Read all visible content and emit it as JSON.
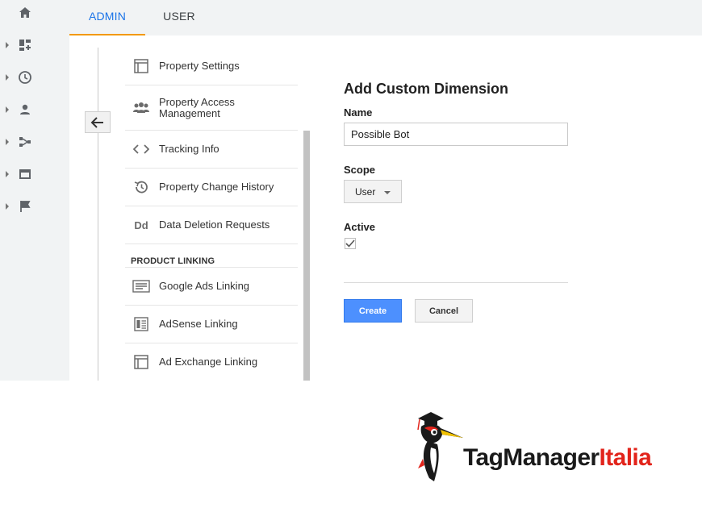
{
  "tabs": [
    {
      "label": "ADMIN",
      "active": true
    },
    {
      "label": "USER",
      "active": false
    }
  ],
  "rail": {
    "items": [
      "home-icon",
      "customization-icon",
      "realtime-clock-icon",
      "audience-person-icon",
      "acquisition-icon",
      "behavior-icon",
      "conversions-flag-icon"
    ]
  },
  "property_menu": {
    "items": [
      {
        "label": "Property Settings",
        "icon": "property-settings-icon"
      },
      {
        "label": "Property Access Management",
        "icon": "people-icon"
      },
      {
        "label": "Tracking Info",
        "icon": "code-icon"
      },
      {
        "label": "Property Change History",
        "icon": "history-icon"
      },
      {
        "label": "Data Deletion Requests",
        "icon": "dd-icon"
      }
    ],
    "section_heading": "PRODUCT LINKING",
    "linking_items": [
      {
        "label": "Google Ads Linking",
        "icon": "ads-icon"
      },
      {
        "label": "AdSense Linking",
        "icon": "adsense-icon"
      },
      {
        "label": "Ad Exchange Linking",
        "icon": "adexchange-icon"
      }
    ]
  },
  "form": {
    "title": "Add Custom Dimension",
    "name_label": "Name",
    "name_value": "Possible Bot",
    "scope_label": "Scope",
    "scope_value": "User",
    "active_label": "Active",
    "active_checked": true,
    "create_label": "Create",
    "cancel_label": "Cancel"
  },
  "logo": {
    "text_dark": "TagManager",
    "text_red": "Italia"
  },
  "colors": {
    "accent_blue": "#1a73e8",
    "tab_underline": "#f29900",
    "create_button": "#4d90fe",
    "logo_red": "#e2241b"
  }
}
